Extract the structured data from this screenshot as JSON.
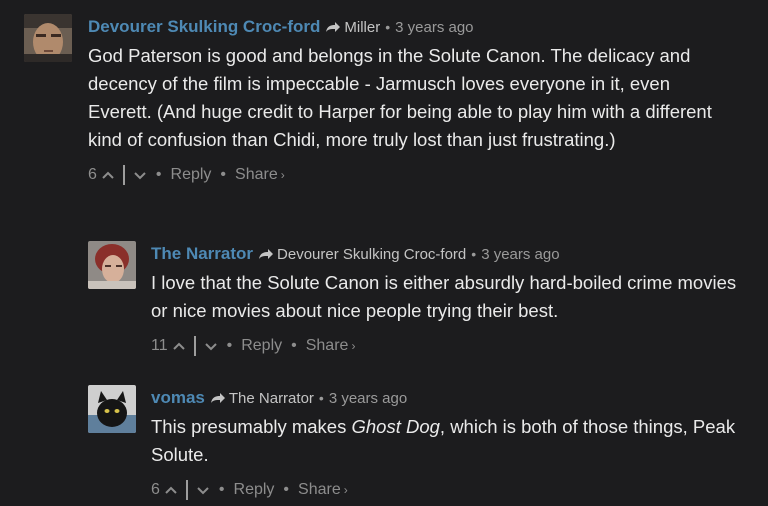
{
  "comments": [
    {
      "author": "Devourer Skulking Croc-ford",
      "parent": "Miller",
      "time": "3 years ago",
      "text": "God Paterson is good and belongs in the Solute Canon. The delicacy and decency of the film is impeccable - Jarmusch loves everyone in it, even Everett. (And huge credit to Harper for being able to play him with a different kind of confusion than Chidi, more truly lost than just frustrating.)",
      "votes": "6",
      "reply": "Reply",
      "share": "Share",
      "share_chevron": "›"
    },
    {
      "author": "The Narrator",
      "parent": "Devourer Skulking Croc-ford",
      "time": "3 years ago",
      "text": "I love that the Solute Canon is either absurdly hard-boiled crime movies or nice movies about nice people trying their best.",
      "votes": "11",
      "reply": "Reply",
      "share": "Share",
      "share_chevron": "›"
    },
    {
      "author": "vomas",
      "parent": "The Narrator",
      "time": "3 years ago",
      "text_before": "This presumably makes ",
      "text_em": "Ghost Dog",
      "text_after": ", which is both of those things, Peak Solute.",
      "votes": "6",
      "reply": "Reply",
      "share": "Share",
      "share_chevron": "›"
    }
  ],
  "separator": "•"
}
